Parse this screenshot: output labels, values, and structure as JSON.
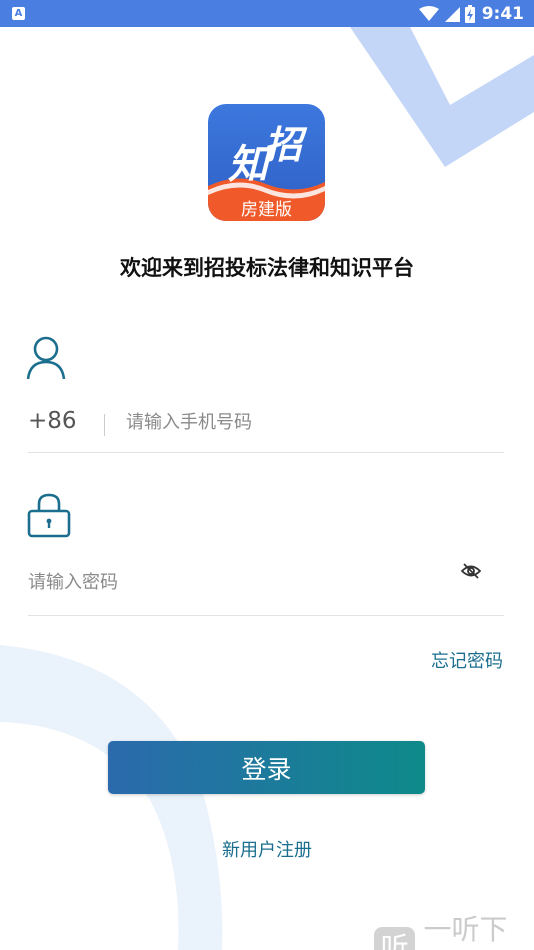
{
  "status_bar": {
    "app_badge": "A",
    "time": "9:41"
  },
  "logo": {
    "char_1": "知",
    "char_2": "招",
    "ribbon_text": "房建版"
  },
  "welcome_title": "欢迎来到招投标法律和知识平台",
  "phone": {
    "country_code": "+86",
    "placeholder": "请输入手机号码",
    "value": ""
  },
  "password": {
    "placeholder": "请输入密码",
    "value": ""
  },
  "forgot_password_label": "忘记密码",
  "login_label": "登录",
  "register_label": "新用户注册",
  "watermark": {
    "badge": "听",
    "text": "一听下载"
  },
  "colors": {
    "status_bar": "#4a7ee0",
    "accent_teal": "#1b6e8e",
    "button_start": "#2b6aad",
    "button_end": "#0e8a8a"
  },
  "icons": [
    "wifi-icon",
    "signal-icon",
    "battery-icon",
    "user-icon",
    "lock-icon",
    "eye-off-icon"
  ]
}
